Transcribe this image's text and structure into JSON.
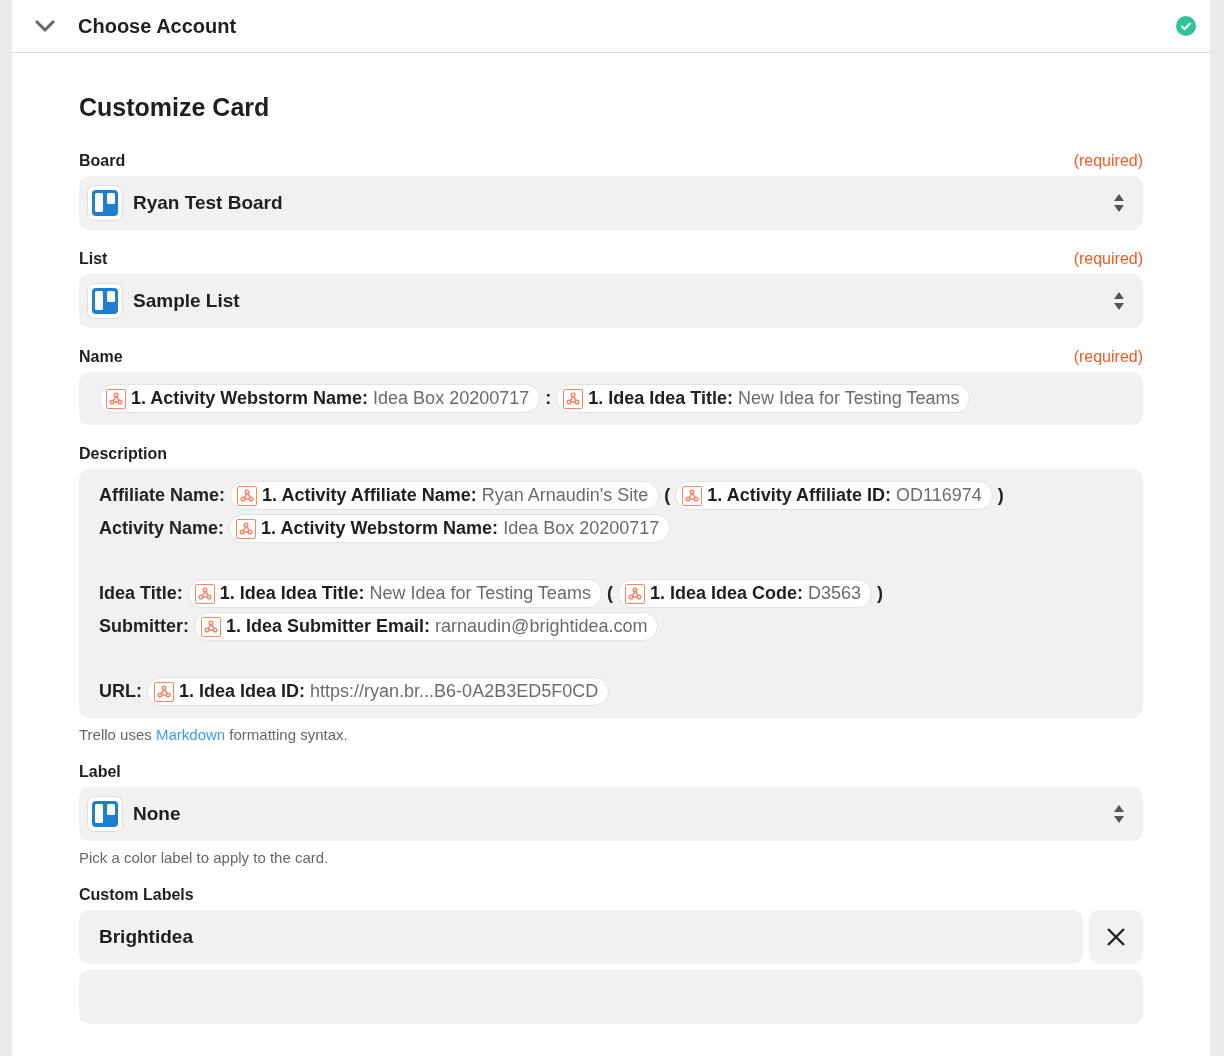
{
  "header": {
    "title": "Choose Account",
    "expanded": true,
    "complete": true
  },
  "section_title": "Customize Card",
  "fields": [
    {
      "kind": "select",
      "label": "Board",
      "required_note": "(required)",
      "value": "Ryan Test Board"
    },
    {
      "kind": "select",
      "label": "List",
      "required_note": "(required)",
      "value": "Sample List"
    },
    {
      "kind": "tokens",
      "label": "Name",
      "required_note": "(required)",
      "lines": [
        {
          "kind": "content",
          "items": [
            {
              "kind": "token",
              "label": "1. Activity Webstorm Name:",
              "value": "Idea Box 20200717"
            },
            {
              "kind": "text",
              "text": ":"
            },
            {
              "kind": "token",
              "label": "1. Idea Idea Title:",
              "value": "New Idea for Testing Teams"
            }
          ]
        }
      ]
    },
    {
      "kind": "tokens",
      "label": "Description",
      "lines": [
        {
          "kind": "content",
          "items": [
            {
              "kind": "text",
              "text": "Affiliate Name:"
            },
            {
              "kind": "token",
              "label": "1. Activity Affiliate Name:",
              "value": "Ryan Arnaudin's Site"
            },
            {
              "kind": "text",
              "text": "("
            },
            {
              "kind": "token",
              "label": "1. Activity Affiliate ID:",
              "value": "OD116974"
            },
            {
              "kind": "text",
              "text": ")"
            }
          ]
        },
        {
          "kind": "content",
          "items": [
            {
              "kind": "text",
              "text": "Activity Name:"
            },
            {
              "kind": "token",
              "label": "1. Activity Webstorm Name:",
              "value": "Idea Box 20200717"
            }
          ]
        },
        {
          "kind": "blank"
        },
        {
          "kind": "content",
          "items": [
            {
              "kind": "text",
              "text": "Idea Title:"
            },
            {
              "kind": "token",
              "label": "1. Idea Idea Title:",
              "value": "New Idea for Testing Teams"
            },
            {
              "kind": "text",
              "text": "("
            },
            {
              "kind": "token",
              "label": "1. Idea Idea Code:",
              "value": "D3563"
            },
            {
              "kind": "text",
              "text": ")"
            }
          ]
        },
        {
          "kind": "content",
          "items": [
            {
              "kind": "text",
              "text": "Submitter:"
            },
            {
              "kind": "token",
              "label": "1. Idea Submitter Email:",
              "value": "rarnaudin@brightidea.com"
            }
          ]
        },
        {
          "kind": "blank"
        },
        {
          "kind": "content",
          "items": [
            {
              "kind": "text",
              "text": "URL:"
            },
            {
              "kind": "token",
              "label": "1. Idea Idea ID:",
              "value": "https://ryan.br...B6-0A2B3ED5F0CD"
            }
          ]
        }
      ],
      "help": {
        "before": "Trello uses",
        "link": "Markdown",
        "after": "formatting syntax."
      }
    },
    {
      "kind": "select",
      "label": "Label",
      "value": "None",
      "help": {
        "before": "Pick a color label to apply to the card."
      }
    },
    {
      "kind": "removable",
      "label": "Custom Labels",
      "values": [
        "Brightidea"
      ]
    }
  ]
}
